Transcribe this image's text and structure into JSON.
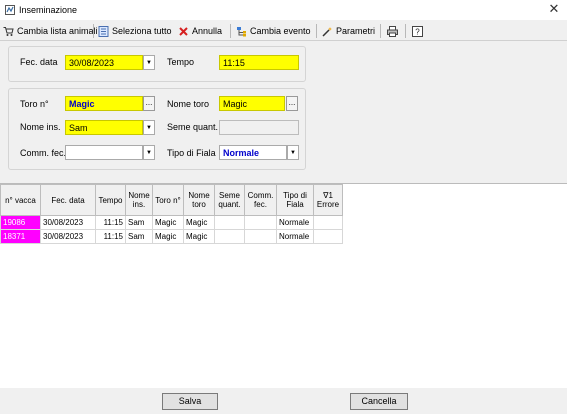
{
  "window": {
    "title": "Inseminazione"
  },
  "toolbar": {
    "items": [
      {
        "label": "Cambia lista animali",
        "icon": "cart-icon"
      },
      {
        "label": "Seleziona tutto",
        "icon": "list-icon"
      },
      {
        "label": "Annulla",
        "icon": "x-icon"
      },
      {
        "label": "Cambia evento",
        "icon": "tree-icon"
      },
      {
        "label": "Parametri",
        "icon": "magic-wand-icon"
      },
      {
        "label": "",
        "icon": "printer-icon"
      },
      {
        "label": "",
        "icon": "help-icon"
      }
    ]
  },
  "form": {
    "fec_data_label": "Fec. data",
    "fec_data_value": "30/08/2023",
    "tempo_label": "Tempo",
    "tempo_value": "11:15",
    "toro_label": "Toro n°",
    "toro_value": "Magic",
    "nome_toro_label": "Nome toro",
    "nome_toro_value": "Magic",
    "nome_ins_label": "Nome ins.",
    "nome_ins_value": "Sam",
    "seme_quant_label": "Seme quant.",
    "seme_quant_value": "",
    "comm_fec_label": "Comm. fec.",
    "comm_fec_value": "",
    "tipo_fiala_label": "Tipo di Fiala",
    "tipo_fiala_value": "Normale",
    "ellipsis": "...",
    "dropdown_arrow": "▼"
  },
  "grid": {
    "headers": [
      "n° vacca",
      "Fec. data",
      "Tempo",
      "Nome ins.",
      "Toro n°",
      "Nome toro",
      "Seme quant.",
      "Comm. fec.",
      "Tipo di Fiala",
      "Errore"
    ],
    "errore_sort_glyph": "∇1",
    "rows": [
      [
        "19086",
        "30/08/2023",
        "11:15",
        "Sam",
        "Magic",
        "Magic",
        "",
        "",
        "Normale",
        ""
      ],
      [
        "18371",
        "30/08/2023",
        "11:15",
        "Sam",
        "Magic",
        "Magic",
        "",
        "",
        "Normale",
        ""
      ]
    ]
  },
  "buttons": {
    "save": "Salva",
    "cancel": "Cancella"
  },
  "colors": {
    "highlight": "#ffff00",
    "cow_id": "#ff00ff",
    "value_blue": "#0000cc"
  }
}
